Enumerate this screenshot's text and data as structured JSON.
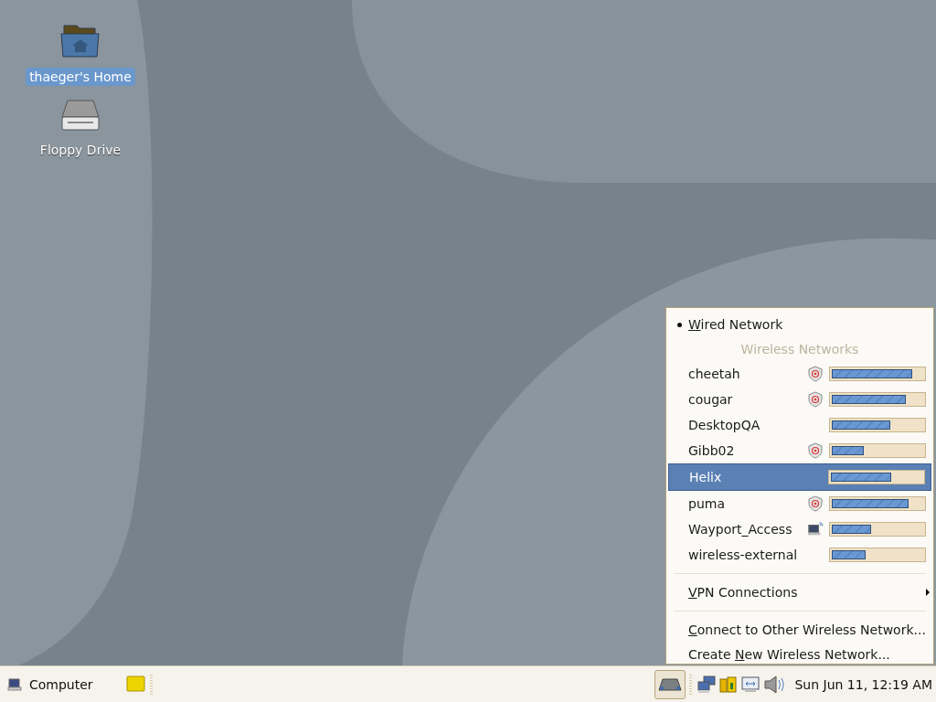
{
  "desktop_icons": [
    {
      "kind": "home",
      "label": "thaeger's Home",
      "selected": true
    },
    {
      "kind": "drive",
      "label": "Floppy Drive",
      "selected": false
    }
  ],
  "network_menu": {
    "wired": {
      "key": "W",
      "post": "ired Network",
      "active": true
    },
    "section_title": "Wireless Networks",
    "networks": [
      {
        "name": "cheetah",
        "encrypted": true,
        "adhoc": false,
        "level": 0.88,
        "selected": false
      },
      {
        "name": "cougar",
        "encrypted": true,
        "adhoc": false,
        "level": 0.81,
        "selected": false
      },
      {
        "name": "DesktopQA",
        "encrypted": false,
        "adhoc": false,
        "level": 0.64,
        "selected": false
      },
      {
        "name": "Gibb02",
        "encrypted": true,
        "adhoc": false,
        "level": 0.35,
        "selected": false
      },
      {
        "name": "Helix",
        "encrypted": false,
        "adhoc": false,
        "level": 0.66,
        "selected": true
      },
      {
        "name": "puma",
        "encrypted": true,
        "adhoc": false,
        "level": 0.84,
        "selected": false
      },
      {
        "name": "Wayport_Access",
        "encrypted": false,
        "adhoc": true,
        "level": 0.43,
        "selected": false
      },
      {
        "name": "wireless-external",
        "encrypted": false,
        "adhoc": false,
        "level": 0.37,
        "selected": false
      }
    ],
    "vpn": {
      "key": "V",
      "post": "PN Connections"
    },
    "actions": [
      {
        "key": "C",
        "post": "onnect to Other Wireless Network..."
      },
      {
        "pre": "Create ",
        "key": "N",
        "post": "ew Wireless Network..."
      }
    ]
  },
  "taskbar": {
    "menu_label": "Computer",
    "clock": "Sun Jun 11, 12:19 AM",
    "network_applet_pressed": true
  }
}
